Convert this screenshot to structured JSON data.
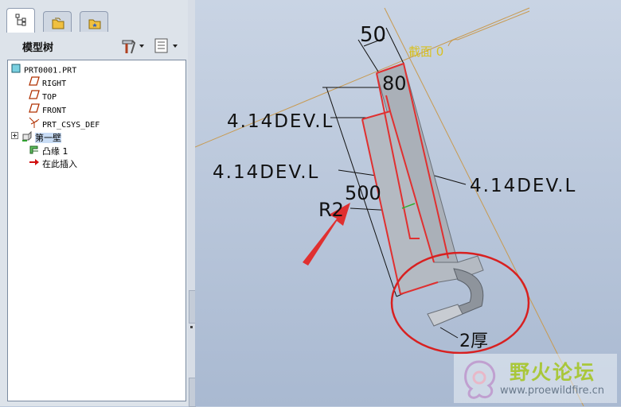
{
  "model_tree": {
    "title": "模型树",
    "items": [
      {
        "label": "PRT0001.PRT",
        "icon": "part-icon"
      },
      {
        "label": "RIGHT",
        "icon": "datum-plane-icon"
      },
      {
        "label": "TOP",
        "icon": "datum-plane-icon"
      },
      {
        "label": "FRONT",
        "icon": "datum-plane-icon"
      },
      {
        "label": "PRT_CSYS_DEF",
        "icon": "csys-icon"
      },
      {
        "label": "第一壁",
        "icon": "sheetmetal-wall-icon"
      },
      {
        "label": "凸缘 1",
        "icon": "flange-icon"
      },
      {
        "label": "在此插入",
        "icon": "insert-here-arrow-icon"
      }
    ]
  },
  "viewport": {
    "dims": {
      "d50": "50",
      "d80": "80",
      "d500": "500",
      "r2": "R2",
      "thick": "2厚",
      "dev_top": "4.14DEV.L",
      "dev_mid": "4.14DEV.L",
      "dev_right": "4.14DEV.L"
    },
    "section_label": "截面 0",
    "colors": {
      "highlight": "#e03030",
      "model": "#a8aeb6",
      "datum": "#c89a50"
    }
  },
  "watermark": {
    "title": "野火论坛",
    "url": "www.proewildfire.cn"
  }
}
